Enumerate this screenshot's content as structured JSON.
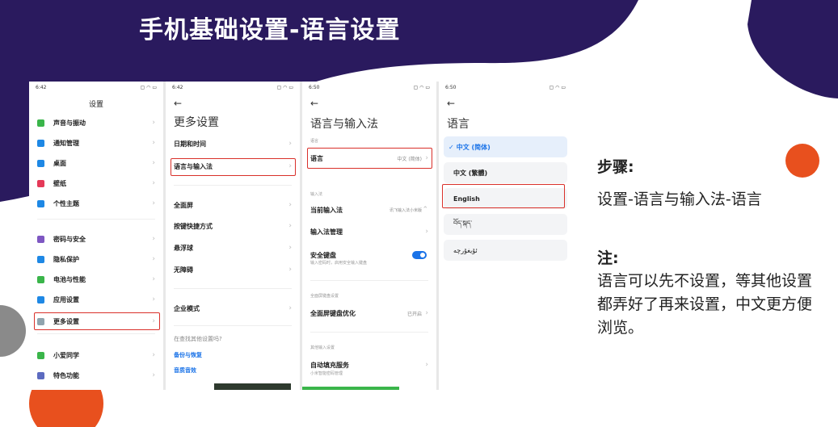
{
  "slide": {
    "title": "手机基础设置-语言设置",
    "steps_heading": "步骤:",
    "steps_text": "设置-语言与输入法-语言",
    "note_heading": "注:",
    "note_text": "语言可以先不设置，等其他设置都弄好了再来设置，中文更方便浏览。",
    "colors": {
      "navy": "#2a1a5e",
      "orange": "#e8501e",
      "gray": "#8a8a8a",
      "highlight": "#d9302a"
    }
  },
  "phone1": {
    "time": "6:42",
    "title": "设置",
    "items": [
      {
        "label": "声音与振动",
        "icon": "sound-icon",
        "color": "#3ab54a"
      },
      {
        "label": "通知管理",
        "icon": "notification-icon",
        "color": "#1e88e5"
      },
      {
        "label": "桌面",
        "icon": "home-icon",
        "color": "#1e88e5"
      },
      {
        "label": "壁纸",
        "icon": "wallpaper-icon",
        "color": "#e53958"
      },
      {
        "label": "个性主题",
        "icon": "theme-icon",
        "color": "#1e88e5"
      },
      {
        "label": "密码与安全",
        "icon": "password-icon",
        "color": "#7e57c2"
      },
      {
        "label": "隐私保护",
        "icon": "privacy-icon",
        "color": "#1e88e5"
      },
      {
        "label": "电池与性能",
        "icon": "battery-icon",
        "color": "#3ab54a"
      },
      {
        "label": "应用设置",
        "icon": "apps-icon",
        "color": "#1e88e5"
      },
      {
        "label": "更多设置",
        "icon": "more-settings-icon",
        "color": "#90a4ae"
      },
      {
        "label": "小爱同学",
        "icon": "xiaoai-icon",
        "color": "#3ab54a"
      },
      {
        "label": "特色功能",
        "icon": "features-icon",
        "color": "#5c6bc0"
      }
    ]
  },
  "phone2": {
    "time": "6:42",
    "title": "更多设置",
    "items": [
      "日期和时间",
      "语言与输入法",
      "全面屏",
      "按键快捷方式",
      "悬浮球",
      "无障碍",
      "企业模式"
    ],
    "search_hint": "在查找其他设置吗?",
    "links": [
      "备份与恢复",
      "音质音效"
    ]
  },
  "phone3": {
    "time": "6:50",
    "title": "语言与输入法",
    "sec_lang": "语言",
    "lang_label": "语言",
    "lang_value": "中文 (简体)",
    "sec_input": "输入法",
    "current_ime": "当前输入法",
    "current_ime_value": "讯飞输入法小米版",
    "ime_manage": "输入法管理",
    "secure_kb": "安全键盘",
    "secure_kb_sub": "输入密码时，启用安全输入键盘",
    "sec_fullscreen": "全面屏键盘设置",
    "fullscreen_opt": "全面屏键盘优化",
    "fullscreen_value": "已开启",
    "sec_other": "其他输入设置",
    "autofill": "自动填充服务",
    "autofill_sub": "小米智能密码管理"
  },
  "phone4": {
    "time": "6:50",
    "title": "语言",
    "languages": [
      "中文 (简体)",
      "中文 (繁體)",
      "English",
      "བོད་སྐད་",
      "ئۇيغۇرچە"
    ],
    "selected_mark": "✓"
  }
}
